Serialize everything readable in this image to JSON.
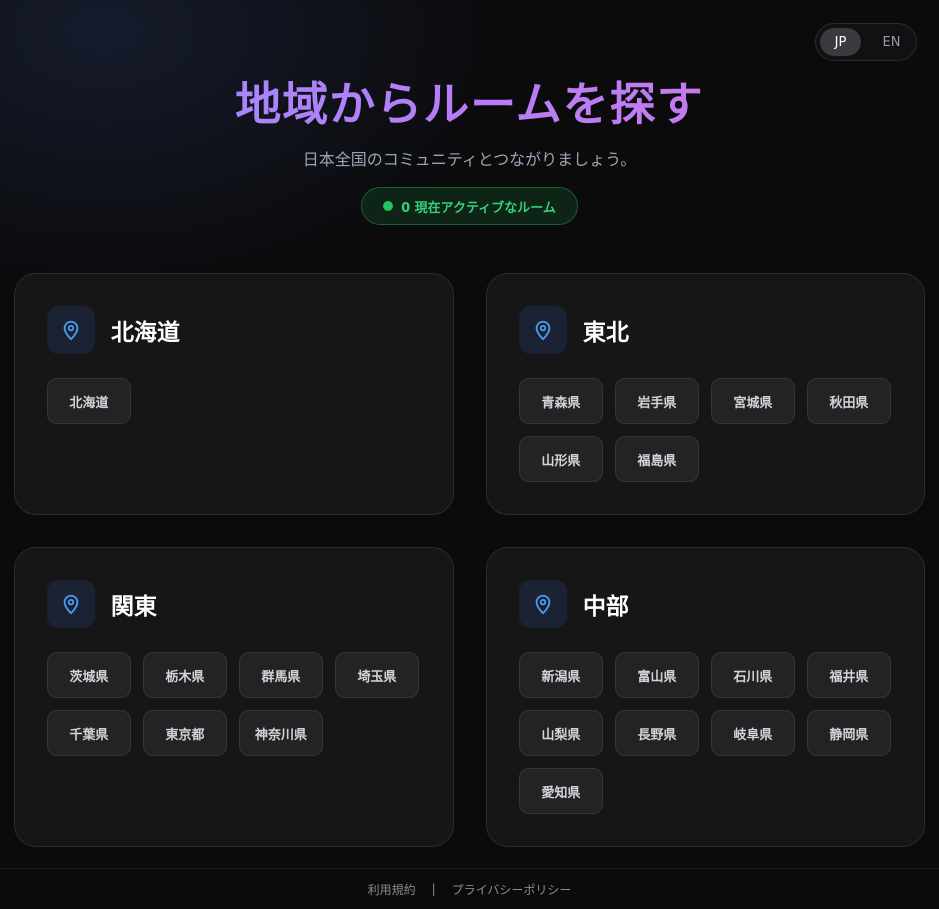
{
  "language_toggle": {
    "jp": "JP",
    "en": "EN",
    "selected": "JP"
  },
  "header": {
    "title": "地域からルームを探す",
    "subtitle": "日本全国のコミュニティとつながりましょう。",
    "active_badge": "0 現在アクティブなルーム"
  },
  "regions": [
    {
      "name": "北海道",
      "prefectures": [
        "北海道"
      ]
    },
    {
      "name": "東北",
      "prefectures": [
        "青森県",
        "岩手県",
        "宮城県",
        "秋田県",
        "山形県",
        "福島県"
      ]
    },
    {
      "name": "関東",
      "prefectures": [
        "茨城県",
        "栃木県",
        "群馬県",
        "埼玉県",
        "千葉県",
        "東京都",
        "神奈川県"
      ]
    },
    {
      "name": "中部",
      "prefectures": [
        "新潟県",
        "富山県",
        "石川県",
        "福井県",
        "山梨県",
        "長野県",
        "岐阜県",
        "静岡県",
        "愛知県"
      ]
    }
  ],
  "footer": {
    "terms": "利用規約",
    "separator": "|",
    "privacy": "プライバシーポリシー"
  },
  "colors": {
    "accent_start": "#9b8cff",
    "accent_end": "#d47ae8",
    "active_green": "#22c55e",
    "pin_blue": "#4a9cf0"
  }
}
